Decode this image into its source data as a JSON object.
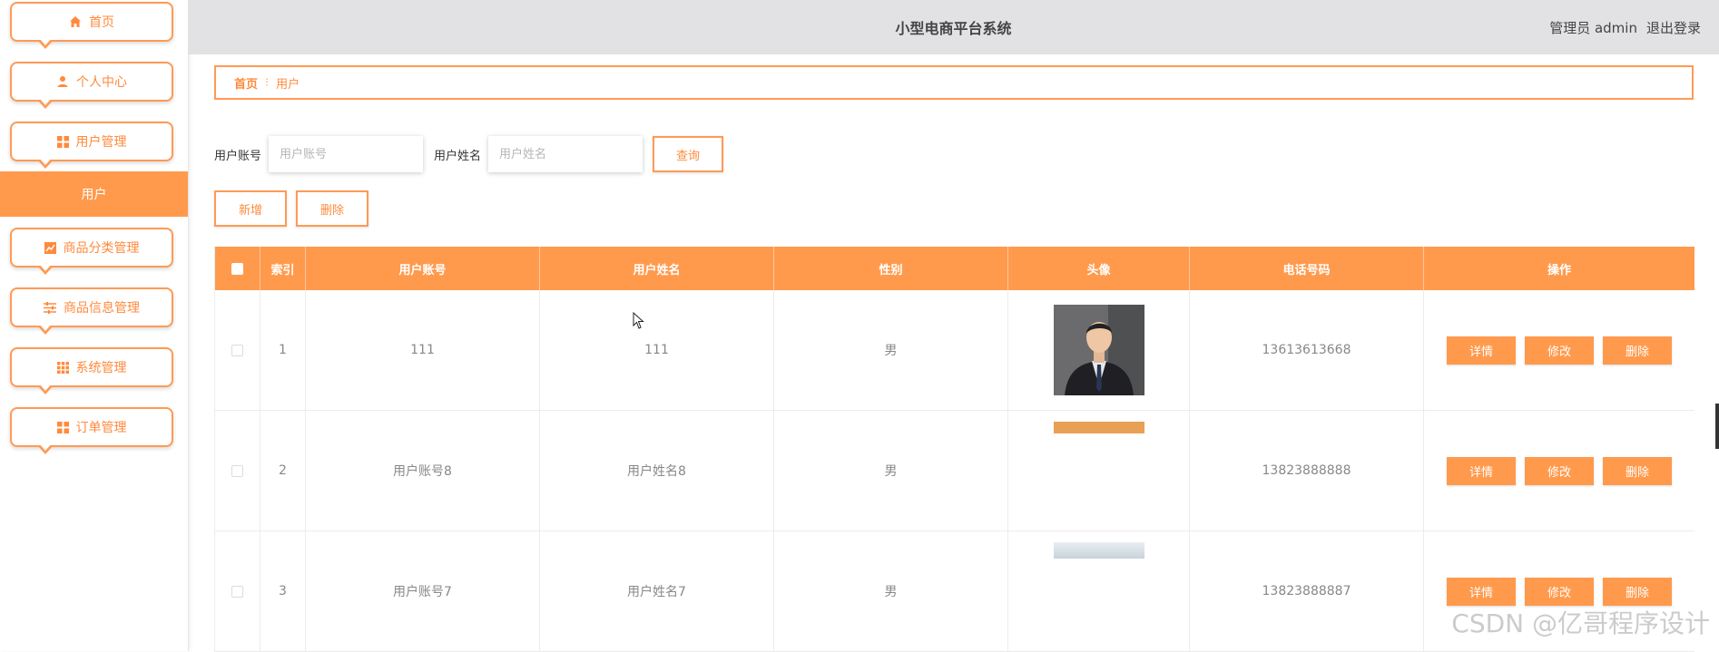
{
  "header": {
    "title": "小型电商平台系统",
    "user_label": "管理员 admin",
    "logout": "退出登录"
  },
  "sidebar": {
    "items": [
      {
        "label": "首页",
        "icon": "home-icon"
      },
      {
        "label": "个人中心",
        "icon": "person-icon"
      },
      {
        "label": "用户管理",
        "icon": "grid-icon"
      },
      {
        "label": "商品分类管理",
        "icon": "chart-icon"
      },
      {
        "label": "商品信息管理",
        "icon": "sliders-icon"
      },
      {
        "label": "系统管理",
        "icon": "apps-icon"
      },
      {
        "label": "订单管理",
        "icon": "grid-icon"
      }
    ],
    "active_sub": "用户"
  },
  "breadcrumb": {
    "home": "首页",
    "sep": "⁝",
    "current": "用户"
  },
  "search": {
    "account_label": "用户账号",
    "account_placeholder": "用户账号",
    "name_label": "用户姓名",
    "name_placeholder": "用户姓名",
    "query_button": "查询"
  },
  "actions": {
    "add": "新增",
    "delete": "删除"
  },
  "table": {
    "headers": [
      "索引",
      "用户账号",
      "用户姓名",
      "性别",
      "头像",
      "电话号码",
      "操作"
    ],
    "rows": [
      {
        "index": "1",
        "account": "111",
        "name": "111",
        "gender": "男",
        "phone": "13613613668"
      },
      {
        "index": "2",
        "account": "用户账号8",
        "name": "用户姓名8",
        "gender": "男",
        "phone": "13823888888"
      },
      {
        "index": "3",
        "account": "用户账号7",
        "name": "用户姓名7",
        "gender": "男",
        "phone": "13823888887"
      }
    ],
    "row_buttons": {
      "detail": "详情",
      "edit": "修改",
      "delete": "删除"
    }
  },
  "watermark": "CSDN @亿哥程序设计",
  "colors": {
    "accent": "#ff9a4d",
    "header_bg": "#e2e2e4"
  }
}
